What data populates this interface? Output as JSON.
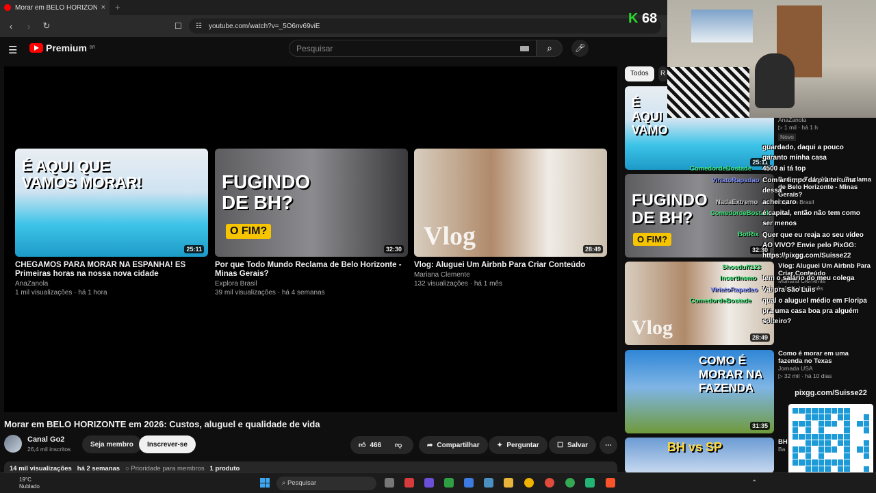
{
  "browser": {
    "tab_title": "Morar em BELO HORIZONTE em",
    "tab_close": "×",
    "new_tab": "+",
    "url": "youtube.com/watch?v=_5O6nv69viE"
  },
  "header": {
    "logo_text": "Premium",
    "logo_region": "BR",
    "search_placeholder": "Pesquisar"
  },
  "end_cards": [
    {
      "thumb_text": "É AQUI QUE VAMOS MORAR!",
      "duration": "25:11",
      "title": "CHEGAMOS PARA MORAR NA ESPANHA! ES Primeiras horas na nossa nova cidade",
      "channel": "AnaZanola",
      "meta": "1 mil visualizações · há 1 hora"
    },
    {
      "thumb_text": "FUGINDO DE BH?",
      "thumb_tag": "O FIM?",
      "duration": "32:30",
      "title": "Por que Todo Mundo Reclama de Belo Horizonte - Minas Gerais?",
      "channel": "Explora Brasil",
      "meta": "39 mil visualizações · há 4 semanas"
    },
    {
      "thumb_text": "Vlog",
      "duration": "28:49",
      "title": "Vlog: Aluguei Um Airbnb Para Criar Conteúdo",
      "channel": "Mariana Clemente",
      "meta": "132 visualizações · há 1 mês"
    }
  ],
  "video": {
    "title": "Morar em BELO HORIZONTE em 2026: Custos, aluguel e qualidade de vida",
    "channel": "Canal Go2",
    "subscribers": "26,4 mil inscritos",
    "member_label": "Seja membro",
    "subscribe_label": "Inscrever-se",
    "likes": "466",
    "share_label": "Compartilhar",
    "ask_label": "Perguntar",
    "save_label": "Salvar",
    "views": "14 mil visualizações",
    "age": "há 2 semanas",
    "priority": "Prioridade para membros",
    "product": "1 produto"
  },
  "sidebar": {
    "chips": [
      "Todos",
      "R"
    ],
    "items": [
      {
        "thumb_text": "É AQUI VAMO",
        "duration": "25:11",
        "channel": "AnaZanola",
        "meta": "1 mil · há 1 h",
        "badge": "Novo"
      },
      {
        "thumb_text": "FUGINDO DE BH?",
        "thumb_tag": "O FIM?",
        "duration": "32:30",
        "title": "Por que Todo Mundo Reclama de Belo Horizonte - Minas Gerais?",
        "channel": "Explora Brasil"
      },
      {
        "thumb_text": "Vlog",
        "duration": "28:49",
        "title": "Vlog: Aluguei Um Airbnb Para Criar Conteúdo",
        "channel": "Mariana Clemente",
        "meta": "132 · há 1 mês"
      },
      {
        "thumb_text": "COMO É MORAR NA FAZENDA",
        "duration": "31:35",
        "title": "Como é morar em uma fazenda no Texas",
        "channel": "Jornada USA",
        "meta": "32 mil · há 10 dias"
      },
      {
        "thumb_text": "BH vs SP",
        "title": "BH",
        "channel": "Ba"
      }
    ]
  },
  "stream": {
    "counter": "68",
    "counter_letter": "K",
    "pix_label": "pixgg.com/Suisse22",
    "chat": [
      {
        "nick": "ComedordeBostade",
        "text": "guardado, daqui a pouco garanto minha casa"
      },
      {
        "nick": "ViriatoRapadao",
        "text": "4500 ai tá top"
      },
      {
        "nick": "NadaExtremo",
        "text": "Com ar limpo da pra ter uma dessa"
      },
      {
        "nick": "ComedordeBostade",
        "text": "achei caro"
      },
      {
        "nick": "BotRix",
        "text": "é capital, então não tem como ser menos"
      },
      {
        "nick": "BotRix",
        "text": "Quer que eu reaja ao seu vídeo AO VIVO? Envie pelo PixGG: https://pixgg.com/Suisse22"
      },
      {
        "nick": "Shoeduff123",
        "text": "tem o salário do meu colega"
      },
      {
        "nick": "Incertinemo",
        "text": "Vai pra São Luis"
      },
      {
        "nick": "ViriatoRapadao",
        "text": "qual o aluguel médio em Floripa pra uma casa boa pra alguém solteiro?"
      },
      {
        "nick": "ComedordeBostade",
        "text": ""
      }
    ]
  },
  "taskbar": {
    "temp": "19°C",
    "weather": "Nublado",
    "search": "Pesquisar"
  }
}
